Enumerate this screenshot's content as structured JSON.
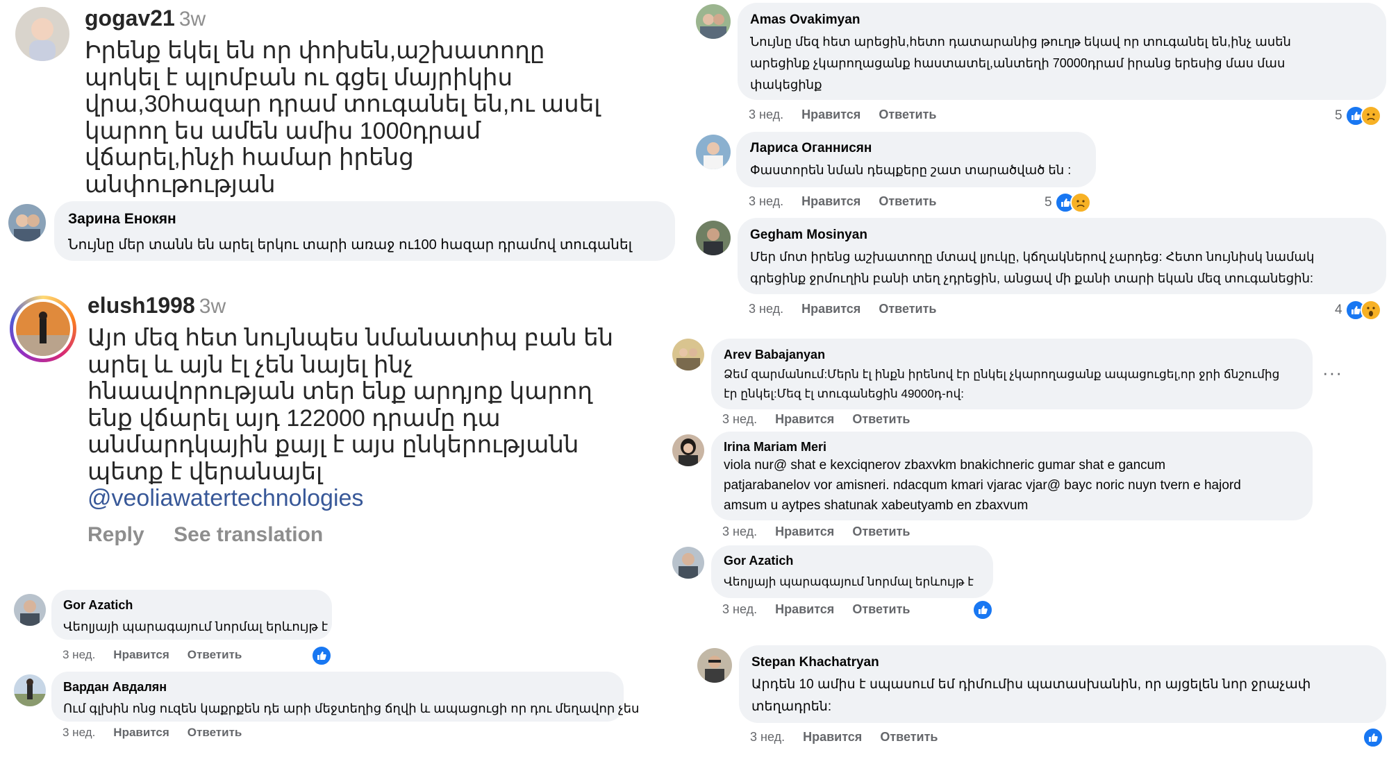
{
  "left_instagram": [
    {
      "user": "gogav21",
      "time": "3w",
      "lines": [
        "Իրենք եկել են որ փոխեն,աշխատողը",
        "պոկել է պլոմբան ու գցել մայրիկիս",
        "վրա,30հազար դրամ տուգանել են,ու ասել",
        "կարող ես ամեն ամիս 1000դրամ",
        "վճարել,ինչի համար իրենց",
        "անփութության"
      ]
    },
    {
      "user": "elush1998",
      "time": "3w",
      "lines": [
        "Այո մեզ հետ նույնպես նմանատիպ բան են",
        "արել և այն էլ չեն նայել ինչ",
        "հնաավորության տեր ենք արդյոք կարող",
        "ենք վճարել այդ 122000 դրամը դա",
        "անմարդկային քայլ է այս ընկերությանն",
        "պետք է վերանայել"
      ],
      "mention": "@veoliawatertechnologies",
      "reply": "Reply",
      "see_translation": "See translation"
    }
  ],
  "left_facebook": [
    {
      "name": "Зарина Енокян",
      "lines": [
        "Նույնը մեր տանն են արել երկու տարի առաջ ու100 հազար դրամով տուգանել"
      ]
    },
    {
      "name": "Gor Azatich",
      "lines": [
        "Վեոլյայի պարագայում նորմալ երևույթ է"
      ],
      "time": "3 нед.",
      "like": "Нравится",
      "reply": "Ответить"
    },
    {
      "name": "Вардан Авдалян",
      "lines": [
        "Ում գլխին ոնց ուզեն կաքրքեն դե արի մեջտեղից ճղվի և ապացուցի որ դու մեղավոր չես"
      ],
      "time": "3 нед.",
      "like": "Нравится",
      "reply": "Ответить"
    }
  ],
  "right_facebook": [
    {
      "name": "Amas Ovakimyan",
      "lines": [
        "Նույնը մեզ հետ արեցին,հետո դատարանից թուղթ եկավ որ տուգանել են,ինչ ասեն",
        "արեցինք չկարողացանք հաստատել,անտեղի 70000դրամ իրանց երեսից մաս մաս",
        "փակեցինք"
      ],
      "time": "3 нед.",
      "like": "Нравится",
      "reply": "Ответить",
      "reaction_count": "5"
    },
    {
      "name": "Лариса Оганнисян",
      "lines": [
        "Փաստորեն նման դեպքերը շատ տարածված են :"
      ],
      "time": "3 нед.",
      "like": "Нравится",
      "reply": "Ответить",
      "reaction_count": "5"
    },
    {
      "name": "Gegham Mosinyan",
      "lines": [
        "Մեր մոտ իրենց աշխատողը մտավ լյուկը, կճղակներով չարդեց: Հետո նույնիսկ նամակ",
        "գրեցինք ջրմուղին բանի տեղ չդրեցին, անցավ մի քանի տարի եկան մեզ տուգանեցին:"
      ],
      "time": "3 нед.",
      "like": "Нравится",
      "reply": "Ответить",
      "reaction_count": "4"
    },
    {
      "name": "Arev Babajanyan",
      "lines": [
        "Ձեմ զարմանում:Մերն էլ ինքն իրենով էր ընկել չկարողացանք ապացուցել,որ ջրի ճնշումից",
        "էր ընկել:Մեզ էլ տուգանեցին 49000դ-ով:"
      ],
      "time": "3 нед.",
      "like": "Нравится",
      "reply": "Ответить",
      "more": "···"
    },
    {
      "name": "Irina Mariam Meri",
      "lines": [
        "viola nur@ shat e kexciqnerov zbaxvkm bnakichneric gumar shat e gancum",
        "patjarabanelov vor amisneri. ndacqum kmari vjarac vjar@ bayc noric nuyn tvern e hajord",
        "amsum u aytpes shatunak xabeutyamb en zbaxvum"
      ],
      "time": "3 нед.",
      "like": "Нравится",
      "reply": "Ответить"
    },
    {
      "name": "Gor Azatich",
      "lines": [
        "Վեոլյայի պարագայում նորմալ երևույթ է"
      ],
      "time": "3 нед.",
      "like": "Нравится",
      "reply": "Ответить"
    },
    {
      "name": "Stepan Khachatryan",
      "lines": [
        "Արդեն 10 ամիս է սպասում եմ դիմումիս պատասխանին, որ այցելեն նոր ջրաչափ",
        "տեղադրեն:"
      ],
      "time": "3 нед.",
      "like": "Нравится",
      "reply": "Ответить"
    }
  ],
  "colors": {
    "bubble": "#f0f2f5",
    "fb_blue": "#1877f2",
    "meta_gray": "#65676b",
    "ig_text": "#262626",
    "ig_gray": "#8e8e8e",
    "ig_mention": "#385898"
  },
  "icons": [
    "like-icon",
    "sad-icon",
    "wow-icon",
    "more-options-icon"
  ]
}
